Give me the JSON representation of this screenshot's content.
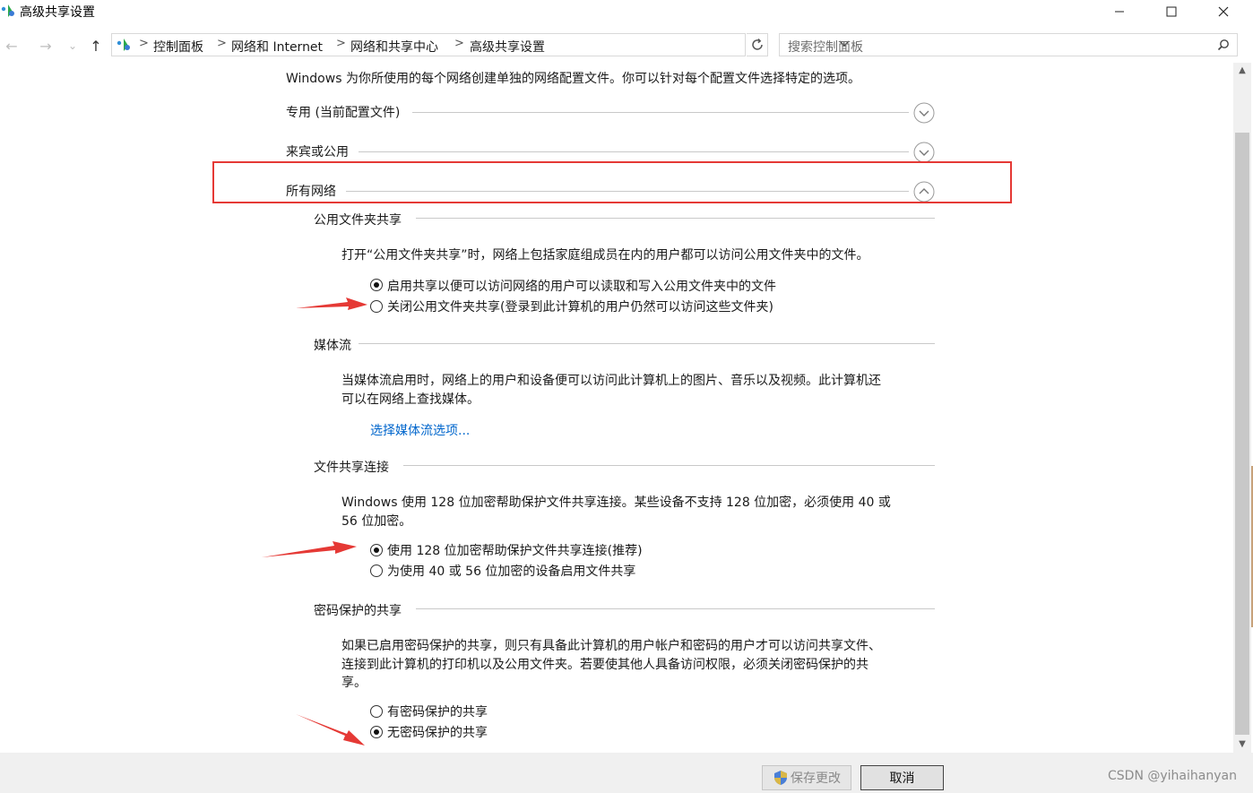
{
  "window": {
    "title": "高级共享设置",
    "minimize_glyph": "—",
    "maximize_glyph": "☐",
    "close_glyph": "✕"
  },
  "nav": {
    "back_glyph": "←",
    "forward_glyph": "→",
    "recent_glyph": "⌄",
    "up_glyph": "↑"
  },
  "breadcrumb": {
    "items": [
      "控制面板",
      "网络和 Internet",
      "网络和共享中心",
      "高级共享设置"
    ],
    "separator": ">"
  },
  "search": {
    "placeholder": "搜索控制面板"
  },
  "content": {
    "intro": "Windows 为你所使用的每个网络创建单独的网络配置文件。你可以针对每个配置文件选择特定的选项。",
    "profiles": [
      {
        "label": "专用 (当前配置文件)",
        "expanded": false
      },
      {
        "label": "来宾或公用",
        "expanded": false
      },
      {
        "label": "所有网络",
        "expanded": true
      }
    ],
    "public_folder": {
      "title": "公用文件夹共享",
      "description": "打开“公用文件夹共享”时，网络上包括家庭组成员在内的用户都可以访问公用文件夹中的文件。",
      "options": [
        {
          "label": "启用共享以便可以访问网络的用户可以读取和写入公用文件夹中的文件",
          "selected": true
        },
        {
          "label": "关闭公用文件夹共享(登录到此计算机的用户仍然可以访问这些文件夹)",
          "selected": false
        }
      ]
    },
    "media": {
      "title": "媒体流",
      "description_line1": "当媒体流启用时，网络上的用户和设备便可以访问此计算机上的图片、音乐以及视频。此计算机还",
      "description_line2": "可以在网络上查找媒体。",
      "link": "选择媒体流选项..."
    },
    "file_sharing": {
      "title": "文件共享连接",
      "description_line1": "Windows 使用 128 位加密帮助保护文件共享连接。某些设备不支持 128 位加密，必须使用 40 或",
      "description_line2": "56 位加密。",
      "options": [
        {
          "label": "使用 128 位加密帮助保护文件共享连接(推荐)",
          "selected": true
        },
        {
          "label": "为使用 40 或 56 位加密的设备启用文件共享",
          "selected": false
        }
      ]
    },
    "password": {
      "title": "密码保护的共享",
      "description_line1": "如果已启用密码保护的共享，则只有具备此计算机的用户帐户和密码的用户才可以访问共享文件、",
      "description_line2": "连接到此计算机的打印机以及公用文件夹。若要使其他人具备访问权限，必须关闭密码保护的共",
      "description_line3": "享。",
      "options": [
        {
          "label": "有密码保护的共享",
          "selected": false
        },
        {
          "label": "无密码保护的共享",
          "selected": true
        }
      ]
    }
  },
  "footer": {
    "save_label": "保存更改",
    "cancel_label": "取消",
    "watermark": "CSDN @yihaihanyan"
  },
  "colors": {
    "annotation_red": "#e53935",
    "link_blue": "#0066cc"
  }
}
